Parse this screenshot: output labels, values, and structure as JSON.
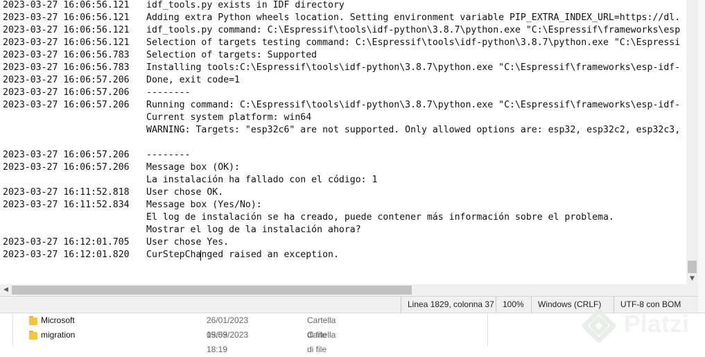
{
  "log": {
    "lines": [
      {
        "ts": "2023-03-27 16:06:56.121",
        "msg": "idf_tools.py exists in IDF directory"
      },
      {
        "ts": "2023-03-27 16:06:56.121",
        "msg": "Adding extra Python wheels location. Setting environment variable PIP_EXTRA_INDEX_URL=https://dl."
      },
      {
        "ts": "2023-03-27 16:06:56.121",
        "msg": "idf_tools.py command: C:\\Espressif\\tools\\idf-python\\3.8.7\\python.exe \"C:\\Espressif\\frameworks\\esp"
      },
      {
        "ts": "2023-03-27 16:06:56.121",
        "msg": "Selection of targets testing command: C:\\Espressif\\tools\\idf-python\\3.8.7\\python.exe \"C:\\Espressi"
      },
      {
        "ts": "2023-03-27 16:06:56.783",
        "msg": "Selection of targets: Supported"
      },
      {
        "ts": "2023-03-27 16:06:56.783",
        "msg": "Installing tools:C:\\Espressif\\tools\\idf-python\\3.8.7\\python.exe \"C:\\Espressif\\frameworks\\esp-idf-"
      },
      {
        "ts": "2023-03-27 16:06:57.206",
        "msg": "Done, exit code=1"
      },
      {
        "ts": "2023-03-27 16:06:57.206",
        "msg": "--------"
      },
      {
        "ts": "2023-03-27 16:06:57.206",
        "msg": "Running command: C:\\Espressif\\tools\\idf-python\\3.8.7\\python.exe \"C:\\Espressif\\frameworks\\esp-idf-"
      },
      {
        "ts": "",
        "msg": "Current system platform: win64"
      },
      {
        "ts": "",
        "msg": "WARNING: Targets: \"esp32c6\" are not supported. Only allowed options are: esp32, esp32c2, esp32c3,"
      },
      {
        "ts": "",
        "msg": ""
      },
      {
        "ts": "2023-03-27 16:06:57.206",
        "msg": "--------"
      },
      {
        "ts": "2023-03-27 16:06:57.206",
        "msg": "Message box (OK):"
      },
      {
        "ts": "",
        "msg": "La instalación ha fallado con el código: 1"
      },
      {
        "ts": "2023-03-27 16:11:52.818",
        "msg": "User chose OK."
      },
      {
        "ts": "2023-03-27 16:11:52.834",
        "msg": "Message box (Yes/No):"
      },
      {
        "ts": "",
        "msg": "El log de instalación se ha creado, puede contener más información sobre el problema."
      },
      {
        "ts": "",
        "msg": "Mostrar el log de la instalación ahora?"
      },
      {
        "ts": "2023-03-27 16:12:01.705",
        "msg": "User chose Yes."
      },
      {
        "ts": "2023-03-27 16:12:01.820",
        "msg": "CurStepChanged raised an exception."
      }
    ]
  },
  "statusbar": {
    "position": "Linea 1829, colonna 37",
    "zoom": "100%",
    "line_ending": "Windows (CRLF)",
    "encoding": "UTF-8 con BOM"
  },
  "explorer": {
    "files": [
      {
        "name": "Microsoft",
        "date": "26/01/2023 09:59",
        "type": "Cartella di file"
      },
      {
        "name": "migration",
        "date": "15/03/2023 18:19",
        "type": "Cartella di file"
      }
    ]
  },
  "watermark": {
    "text": "Platzi"
  },
  "colors": {
    "folder": "#f5c542",
    "statusbar_bg": "#f0f0f0",
    "scrollbar_thumb": "#c1c1c1"
  },
  "icons": [
    "scroll-down-arrow-icon",
    "scroll-left-arrow-icon",
    "folder-icon",
    "platzi-logo-icon"
  ]
}
